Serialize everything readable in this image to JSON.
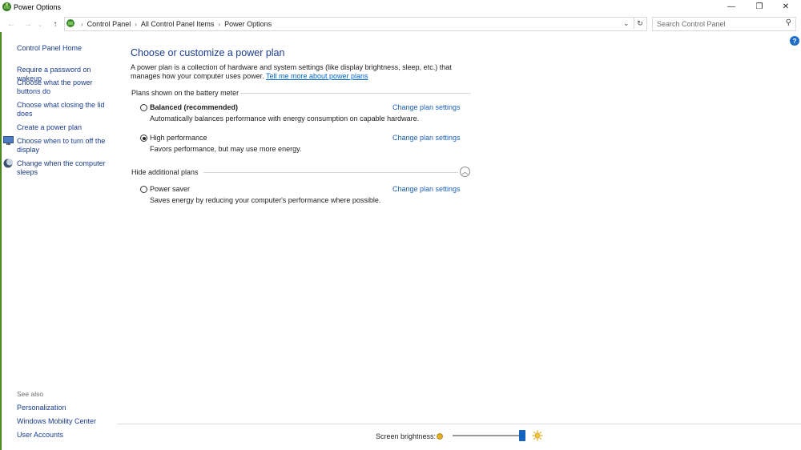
{
  "window": {
    "title": "Power Options",
    "minimize_glyph": "—",
    "maximize_glyph": "❐",
    "close_glyph": "✕"
  },
  "address": {
    "crumbs": [
      "Control Panel",
      "All Control Panel Items",
      "Power Options"
    ],
    "search_placeholder": "Search Control Panel"
  },
  "sidebar": {
    "home": "Control Panel Home",
    "items": [
      "Require a password on wakeup",
      "Choose what the power buttons do",
      "Choose what closing the lid does",
      "Create a power plan",
      "Choose when to turn off the display",
      "Change when the computer sleeps"
    ],
    "see_also_label": "See also",
    "see_also": [
      "Personalization",
      "Windows Mobility Center",
      "User Accounts"
    ]
  },
  "main": {
    "heading": "Choose or customize a power plan",
    "intro": "A power plan is a collection of hardware and system settings (like display brightness, sleep, etc.) that manages how your computer uses power.",
    "intro_link": "Tell me more about power plans",
    "battery_meter_label": "Plans shown on the battery meter",
    "hide_additional_label": "Hide additional plans",
    "change_link_label": "Change plan settings",
    "plans": [
      {
        "name": "Balanced (recommended)",
        "desc": "Automatically balances performance with energy consumption on capable hardware.",
        "selected": false
      },
      {
        "name": "High performance",
        "desc": "Favors performance, but may use more energy.",
        "selected": true
      },
      {
        "name": "Power saver",
        "desc": "Saves energy by reducing your computer's performance where possible.",
        "selected": false
      }
    ]
  },
  "brightness": {
    "label": "Screen brightness:",
    "level": 0.97
  },
  "colors": {
    "link": "#1a3d8f",
    "accent": "#1565c0"
  }
}
